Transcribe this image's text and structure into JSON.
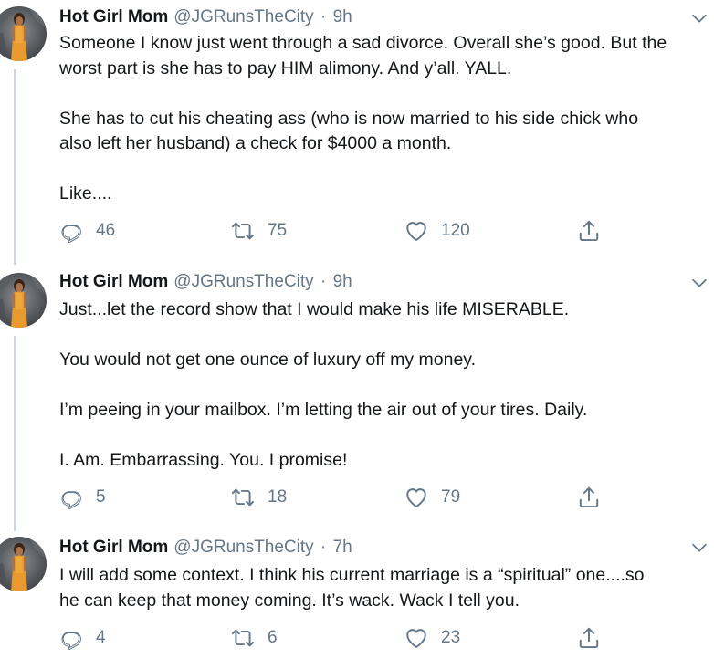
{
  "tweets": [
    {
      "name": "Hot Girl Mom",
      "handle": "@JGRunsTheCity",
      "separator": "·",
      "time": "9h",
      "paragraphs": [
        [
          "Someone I know just went through a sad divorce. Overall she’s good. But the",
          "worst part is she has to pay HIM alimony. And y’all. YALL."
        ],
        [
          "She has to cut his cheating ass (who is now married to his side chick who",
          "also left her husband) a check for $4000 a month."
        ],
        [
          "Like...."
        ]
      ],
      "replies": "46",
      "retweets": "75",
      "likes": "120"
    },
    {
      "name": "Hot Girl Mom",
      "handle": "@JGRunsTheCity",
      "separator": "·",
      "time": "9h",
      "paragraphs": [
        [
          "Just...let the record show that I would make his life MISERABLE."
        ],
        [
          "You would not get one ounce of luxury off my money."
        ],
        [
          "I’m peeing in your mailbox. I’m letting the air out of your tires. Daily."
        ],
        [
          "I. Am. Embarrassing. You. I promise!"
        ]
      ],
      "replies": "5",
      "retweets": "18",
      "likes": "79"
    },
    {
      "name": "Hot Girl Mom",
      "handle": "@JGRunsTheCity",
      "separator": "·",
      "time": "7h",
      "paragraphs": [
        [
          "I will add some context. I think his current marriage is a “spiritual” one....so",
          "he can keep that money coming. It’s wack. Wack I tell you."
        ]
      ],
      "replies": "4",
      "retweets": "6",
      "likes": "23"
    }
  ],
  "icons": {
    "reply": "reply-icon",
    "retweet": "retweet-icon",
    "like": "heart-icon",
    "share": "share-icon",
    "caret": "chevron-down-icon",
    "avatar": "avatar"
  },
  "colors": {
    "text": "#14171a",
    "muted": "#657786",
    "thread_line": "#ccd6dd",
    "background": "#ffffff"
  }
}
